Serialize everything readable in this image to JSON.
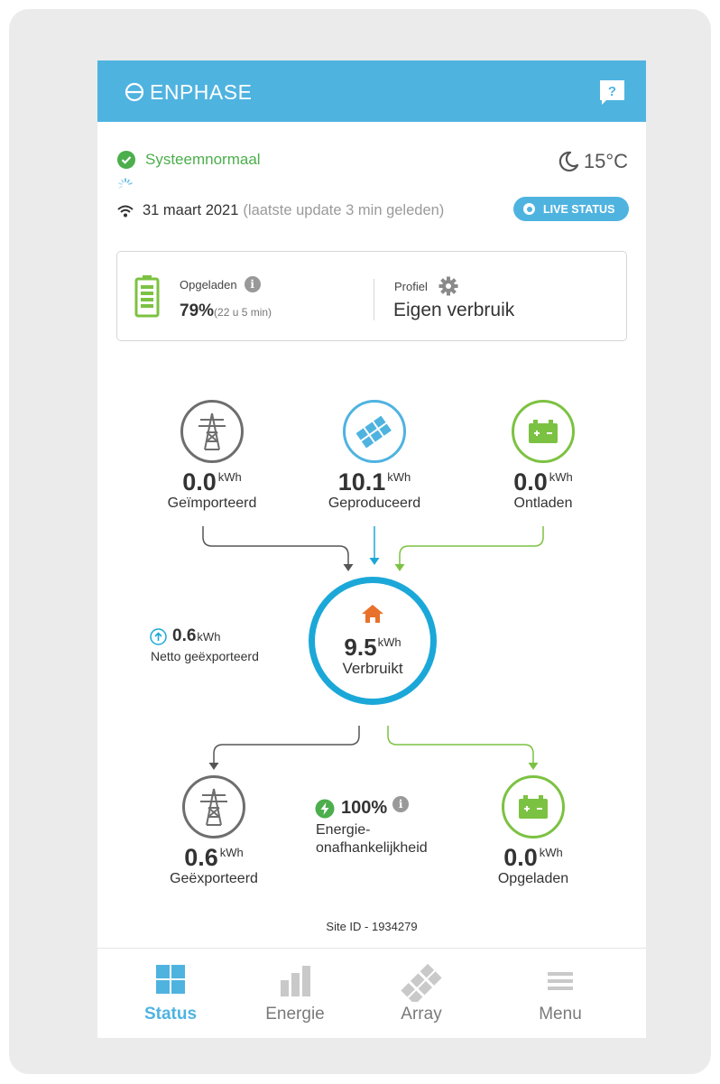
{
  "colors": {
    "brand_blue": "#4fb3e0",
    "consumption_blue": "#1ba8d8",
    "battery_green": "#7cc242",
    "ok_green": "#4cae4c",
    "home_orange": "#e8712b",
    "grid_gray": "#6e6e6e"
  },
  "header": {
    "logo_text": "ENPHASE",
    "help_label": "?"
  },
  "status": {
    "system_text": "Systeemnormaal",
    "temperature": "15°C",
    "date": "31 maart 2021",
    "last_update": "(laatste update 3 min geleden)",
    "live_status_label": "LIVE STATUS"
  },
  "battery_card": {
    "charged_label": "Opgeladen",
    "charge_percent": "79%",
    "charge_time": "(22 u 5 min)",
    "charge_level": 0.79,
    "profile_label": "Profiel",
    "profile_value": "Eigen verbruik"
  },
  "flow": {
    "imported": {
      "value": "0.0",
      "unit": "kWh",
      "label": "Geïmporteerd"
    },
    "produced": {
      "value": "10.1",
      "unit": "kWh",
      "label": "Geproduceerd"
    },
    "discharged": {
      "value": "0.0",
      "unit": "kWh",
      "label": "Ontladen"
    },
    "consumed": {
      "value": "9.5",
      "unit": "kWh",
      "label": "Verbruikt"
    },
    "net_exported": {
      "value": "0.6",
      "unit": "kWh",
      "label": "Netto geëxporteerd"
    },
    "exported": {
      "value": "0.6",
      "unit": "kWh",
      "label": "Geëxporteerd"
    },
    "independence": {
      "value": "100%",
      "label_line1": "Energie-",
      "label_line2": "onafhankelijkheid"
    },
    "charged": {
      "value": "0.0",
      "unit": "kWh",
      "label": "Opgeladen"
    }
  },
  "site_id": "Site ID - 1934279",
  "tabs": [
    {
      "label": "Status",
      "active": true
    },
    {
      "label": "Energie",
      "active": false
    },
    {
      "label": "Array",
      "active": false
    },
    {
      "label": "Menu",
      "active": false
    }
  ]
}
